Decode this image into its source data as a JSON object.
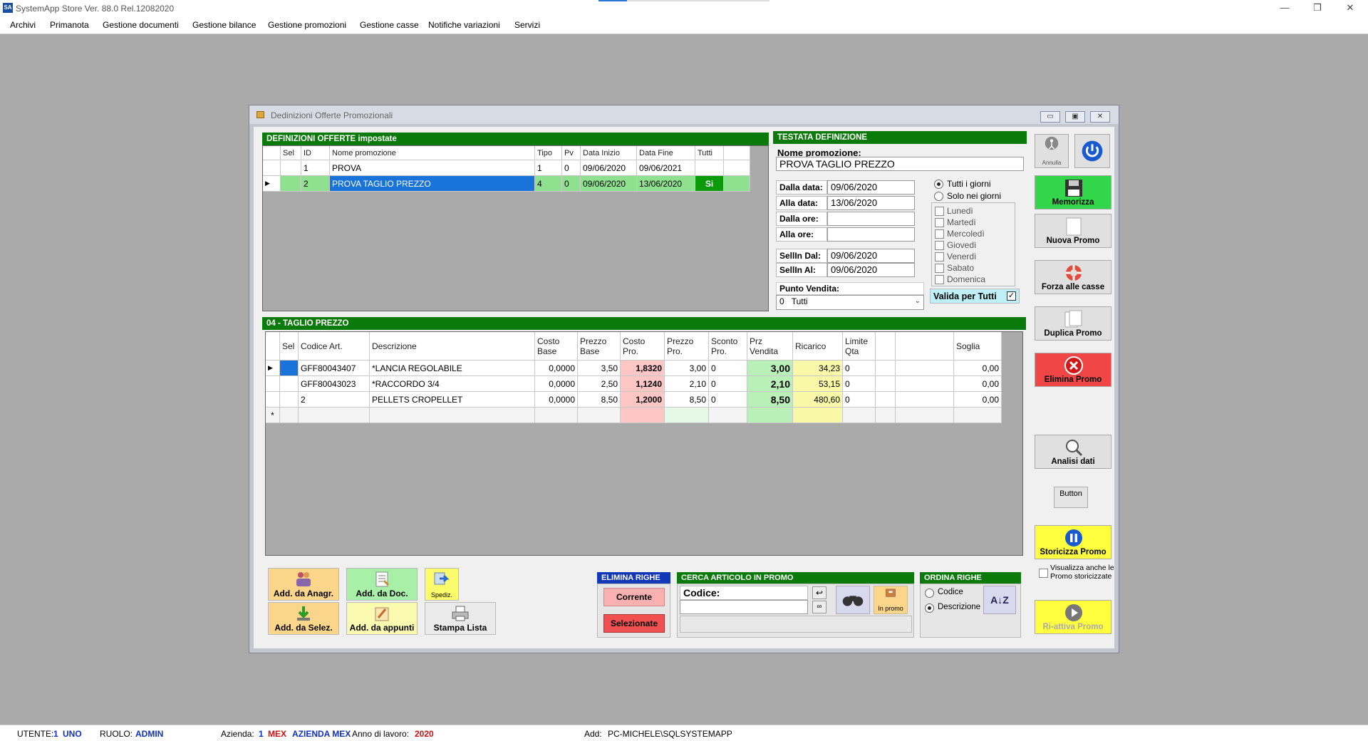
{
  "app": {
    "title": "SystemApp Store Ver. 88.0   Rel.12082020",
    "icon_text": "SA",
    "window_controls": [
      "—",
      "❐",
      "✕"
    ]
  },
  "menu": [
    "Archivi",
    "Primanota",
    "Gestione documenti",
    "Gestione bilance",
    "Gestione promozioni",
    "Gestione casse",
    "Notifiche variazioni",
    "Servizi"
  ],
  "child": {
    "title": "Dedinizioni Offerte Promozionali",
    "controls": [
      "▭",
      "▣",
      "✕"
    ]
  },
  "definizioni": {
    "header": "DEFINIZIONI OFFERTE impostate",
    "columns": [
      "Sel",
      "ID",
      "Nome promozione",
      "Tipo",
      "Pv",
      "Data Inizio",
      "Data Fine",
      "Tutti"
    ],
    "rows": [
      {
        "sel": "",
        "id": "1",
        "nome": "PROVA",
        "tipo": "1",
        "pv": "0",
        "inizio": "09/06/2020",
        "fine": "09/06/2021",
        "tutti": ""
      },
      {
        "sel": "▶",
        "id": "2",
        "nome": "PROVA TAGLIO PREZZO",
        "tipo": "4",
        "pv": "0",
        "inizio": "09/06/2020",
        "fine": "13/06/2020",
        "tutti": "Si"
      }
    ]
  },
  "testata": {
    "header": "TESTATA DEFINIZIONE",
    "nome_label": "Nome promozione:",
    "nome_value": "PROVA TAGLIO PREZZO",
    "dalla_data_label": "Dalla data:",
    "dalla_data": "09/06/2020",
    "alla_data_label": "Alla data:",
    "alla_data": "13/06/2020",
    "dalle_ore_label": "Dalla ore:",
    "dalle_ore": "",
    "alle_ore_label": "Alla ore:",
    "alle_ore": "",
    "sellin_dal_label": "SellIn Dal:",
    "sellin_dal": "09/06/2020",
    "sellin_al_label": "SellIn Al:",
    "sellin_al": "09/06/2020",
    "punto_vendita_label": "Punto Vendita:",
    "punto_vendita_code": "0",
    "punto_vendita_value": "Tutti",
    "radio_tutti": "Tutti i giorni",
    "radio_solo": "Solo nei giorni",
    "giorni": [
      "Lunedì",
      "Martedì",
      "Mercoledì",
      "Giovedì",
      "Venerdì",
      "Sabato",
      "Domenica"
    ],
    "valida_label": "Valida per Tutti"
  },
  "taglio": {
    "header": "04 - TAGLIO PREZZO",
    "columns": [
      "Sel",
      "Codice Art.",
      "Descrizione",
      "Costo Base",
      "Prezzo Base",
      "Costo Pro.",
      "Prezzo Pro.",
      "Sconto Pro.",
      "Prz Vendita",
      "Ricarico",
      "Limite Qta",
      "",
      "",
      "Soglia"
    ],
    "rows": [
      {
        "mark": "▶",
        "codice": "GFF80043407",
        "descr": "*LANCIA REGOLABILE",
        "costo_base": "0,0000",
        "prezzo_base": "3,50",
        "costo_pro": "1,8320",
        "prezzo_pro": "3,00",
        "sconto": "0",
        "prz_vendita": "3,00",
        "ricarico": "34,23",
        "limite": "0",
        "soglia": "0,00"
      },
      {
        "mark": "",
        "codice": "GFF80043023",
        "descr": "*RACCORDO 3/4",
        "costo_base": "0,0000",
        "prezzo_base": "2,50",
        "costo_pro": "1,1240",
        "prezzo_pro": "2,10",
        "sconto": "0",
        "prz_vendita": "2,10",
        "ricarico": "53,15",
        "limite": "0",
        "soglia": "0,00"
      },
      {
        "mark": "",
        "codice": "2",
        "descr": "PELLETS CROPELLET",
        "costo_base": "0,0000",
        "prezzo_base": "8,50",
        "costo_pro": "1,2000",
        "prezzo_pro": "8,50",
        "sconto": "0",
        "prz_vendita": "8,50",
        "ricarico": "480,60",
        "limite": "0",
        "soglia": "0,00"
      }
    ],
    "new_row_mark": "*"
  },
  "buttons_right": {
    "annulla": "Annulla",
    "memorizza": "Memorizza",
    "nuova": "Nuova Promo",
    "forza": "Forza alle casse",
    "duplica": "Duplica Promo",
    "elimina": "Elimina Promo",
    "analisi": "Analisi dati",
    "button": "Button",
    "storicizza": "Storicizza Promo",
    "visualizza": "Visualizza anche le Promo storicizzate",
    "riattiva": "Ri-attiva Promo"
  },
  "buttons_bottom": {
    "add_anagr": "Add. da Anagr.",
    "add_doc": "Add. da Doc.",
    "spediz": "Spediz.",
    "add_selez": "Add. da Selez.",
    "add_appunti": "Add. da appunti",
    "stampa": "Stampa Lista"
  },
  "elimina_righe": {
    "header": "ELIMINA RIGHE",
    "corrente": "Corrente",
    "selezionate": "Selezionate"
  },
  "cerca": {
    "header": "CERCA ARTICOLO IN PROMO",
    "codice_label": "Codice:",
    "in_promo": "In promo"
  },
  "ordina": {
    "header": "ORDINA RIGHE",
    "codice": "Codice",
    "descrizione": "Descrizione"
  },
  "status": {
    "utente_label": "UTENTE:",
    "utente_id": "1",
    "utente_name": "UNO",
    "ruolo_label": "RUOLO:",
    "ruolo": "ADMIN",
    "azienda_label": "Azienda:",
    "azienda_id": "1",
    "azienda_code": "MEX",
    "azienda_name": "AZIENDA MEX",
    "anno_label": "Anno di lavoro:",
    "anno": "2020",
    "add_label": "Add:",
    "add_value": "PC-MICHELE\\SQLSYSTEMAPP"
  },
  "colors": {
    "section_green": "#0a7a0a",
    "section_blue": "#1238b8",
    "selection_blue": "#1a73d9",
    "memorizza_green": "#33d64a",
    "elimina_red": "#f04646",
    "storicizza_yellow": "#ffff40"
  }
}
